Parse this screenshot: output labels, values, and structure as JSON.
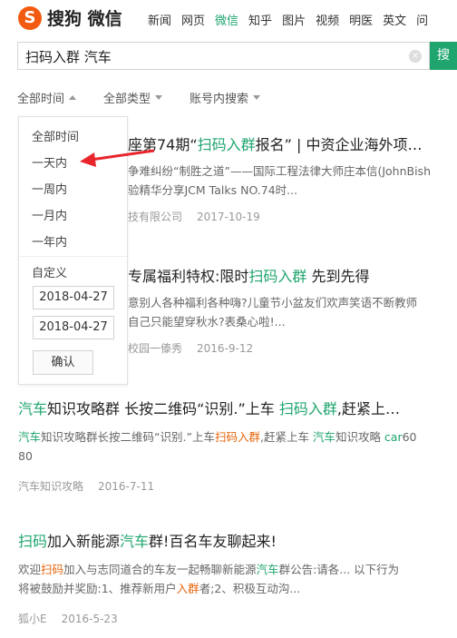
{
  "header": {
    "logo_letter": "S",
    "logo_text": "搜狗",
    "logo_sub": "微信",
    "navs": [
      "新闻",
      "网页",
      "微信",
      "知乎",
      "图片",
      "视频",
      "明医",
      "英文",
      "问"
    ]
  },
  "search": {
    "value": "扫码入群  汽车",
    "clear": "×",
    "button": "搜"
  },
  "filters": [
    "全部时间",
    "全部类型",
    "账号内搜索"
  ],
  "dropdown": {
    "items": [
      "全部时间",
      "一天内",
      "一周内",
      "一月内",
      "一年内"
    ],
    "custom_label": "自定义",
    "date_from": "2018-04-27",
    "date_to": "2018-04-27",
    "confirm": "确认"
  },
  "results": [
    {
      "title_pre": "座第74期“",
      "title_hl": "扫码入群",
      "title_post": "报名” | 中资企业海外项…",
      "snippet1": "争难纠纷“制胜之道”——国际工程法律大师庄本信(JohnBish",
      "snippet2": "验精华分享JCM Talks NO.74时...",
      "source": "技有限公司",
      "date": "2017-10-19"
    },
    {
      "title_pre": "专属福利特权:限时",
      "title_hl": "扫码入群",
      "title_post": " 先到先得",
      "snippet1": "意别人各种福利各种嗨?儿童节小盆友们欢声笑语不断教师",
      "snippet2": "自己只能望穿秋水?表桑心啦!...",
      "source": "校园一傣秀",
      "date": "2016-9-12"
    },
    {
      "title_hl1": "汽车",
      "title_mid": "知识攻略群 长按二维码“识别.”上车 ",
      "title_hl2": "扫码入群",
      "title_post": ",赶紧上…",
      "s_hl1": "汽车",
      "s_t1": "知识攻略群长按二维码“识别.”上车",
      "s_hl2": "扫码入群",
      "s_t2": ",赶紧上车 ",
      "s_hl3": "汽车",
      "s_t3": "知识攻略 ",
      "s_hl4": "car",
      "s_t4": "60",
      "s_line2": "80",
      "source": "汽车知识攻略",
      "date": "2016-7-11"
    },
    {
      "title_hl1": "扫码",
      "title_mid": "加入新能源",
      "title_hl2": "汽车",
      "title_post": "群!百名车友聊起来!",
      "s_t0": "欢迎",
      "s_hl1": "扫码",
      "s_t1": "加入与志同道合的车友一起畅聊新能源",
      "s_hl2": "汽车",
      "s_t2": "群公告:请各... 以下行为",
      "s_t3": "将被鼓励并奖励:1、推荐新用户",
      "s_hl3": "入群",
      "s_t4": "者;2、积极互动沟...",
      "source": "狐小E",
      "date": "2016-5-23"
    }
  ],
  "colors": {
    "accent": "#1fa56d",
    "logo": "#f25a0f",
    "arrow": "#e8252b"
  }
}
